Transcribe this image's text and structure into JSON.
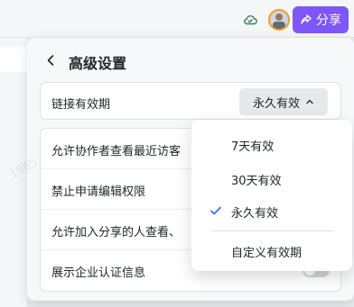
{
  "topbar": {
    "share_label": "分享"
  },
  "panel": {
    "title": "高级设置",
    "link_expiry_label": "链接有效期",
    "link_expiry_value": "永久有效",
    "options": [
      {
        "label": "允许协作者查看最近访客"
      },
      {
        "label": "禁止申请编辑权限"
      },
      {
        "label": "允许加入分享的人查看、"
      },
      {
        "label": "展示企业认证信息"
      }
    ]
  },
  "watermark": {
    "text_a": "吴楠1865",
    "text_b": "1865",
    "text_c": "吴楠1"
  },
  "dropdown": {
    "items": [
      {
        "label": "7天有效"
      },
      {
        "label": "30天有效"
      },
      {
        "label": "永久有效",
        "selected": true
      },
      {
        "label": "自定义有效期"
      }
    ]
  },
  "colors": {
    "accent": "#7e57f6",
    "check": "#3370ff"
  }
}
